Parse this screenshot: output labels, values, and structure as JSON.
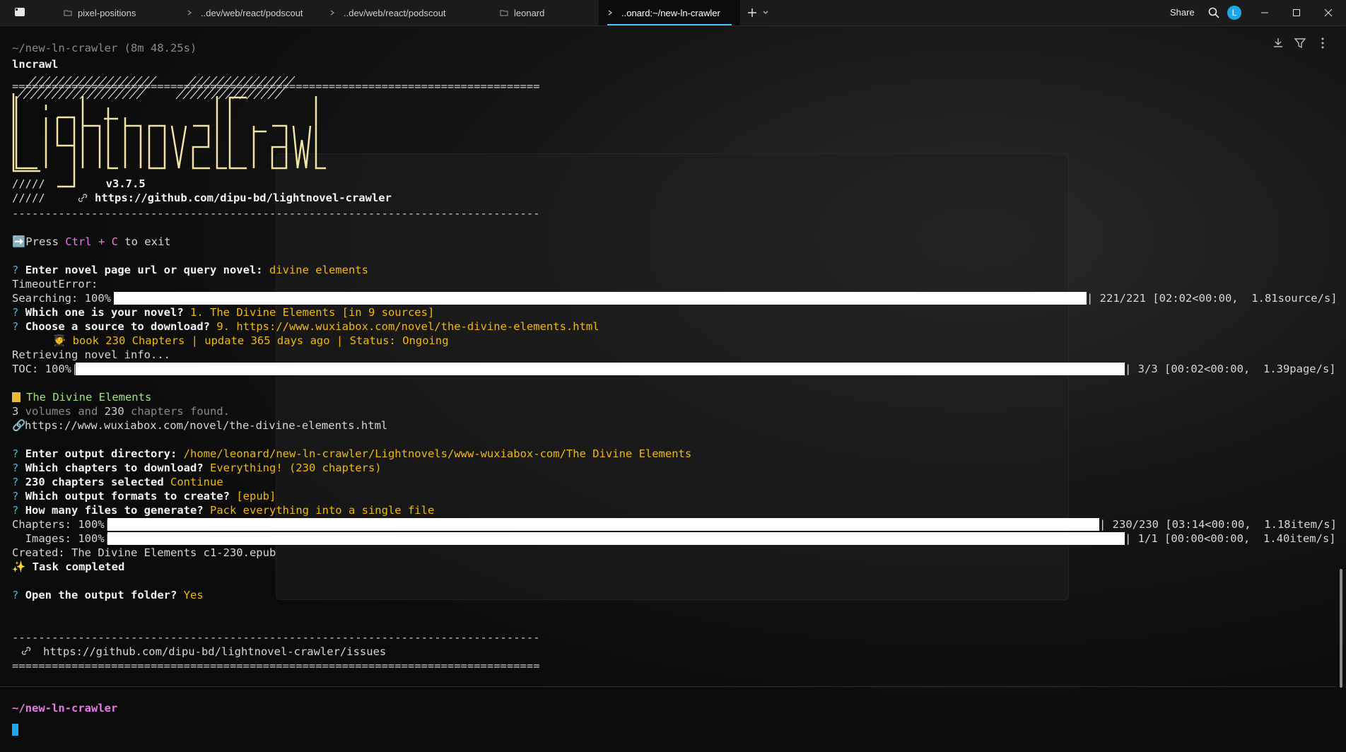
{
  "titlebar": {
    "tabs": [
      {
        "label": "pixel-positions",
        "icon": "folder-icon",
        "active": false
      },
      {
        "label": "..dev/web/react/podscout",
        "icon": "terminal-prompt-icon",
        "active": false
      },
      {
        "label": "..dev/web/react/podscout",
        "icon": "terminal-prompt-icon",
        "active": false
      },
      {
        "label": "leonard",
        "icon": "folder-icon",
        "active": false
      },
      {
        "label": "..onard:~/new-ln-crawler",
        "icon": "terminal-prompt-icon",
        "active": true
      }
    ],
    "share_label": "Share",
    "avatar_initial": "L",
    "accent": "#4cc2ff"
  },
  "terminal": {
    "header_path": "~/new-ln-crawler (8m 48.25s)",
    "command": "lncrawl",
    "sep_double": "================================================================================",
    "sep_single": "--------------------------------------------------------------------------------",
    "logo_text": "Lightnovel Crawler",
    "logo_slashes": "/////",
    "version": "v3.7.5",
    "repo_url": "https://github.com/dipu-bd/lightnovel-crawler",
    "press_prefix": "➡️Press ",
    "press_keys": "Ctrl + C",
    "press_suffix": " to exit",
    "q_mark": "?",
    "q1": "Enter novel page url or query novel:",
    "a1": "divine elements",
    "timeout": "TimeoutError:",
    "search_label": "Searching: 100%|",
    "search_tail": "| 221/221 [02:02<00:00,  1.81source/s]",
    "q2": "Which one is your novel?",
    "a2": "1. The Divine Elements [in 9 sources]",
    "q3": "Choose a source to download?",
    "a3": "9. https://www.wuxiabox.com/novel/the-divine-elements.html",
    "book_info": "🧑‍🎓 book 230 Chapters | update 365 days ago | Status: Ongoing",
    "retrieving": "Retrieving novel info...",
    "toc_label": "TOC: 100%|",
    "toc_tail": "| 3/3 [00:02<00:00,  1.39page/s]",
    "novel_title": "The Divine Elements",
    "volumes_count": "3",
    "volumes_mid": " volumes and ",
    "chapters_count": "230",
    "chapters_suffix": " chapters found.",
    "novel_url": "https://www.wuxiabox.com/novel/the-divine-elements.html",
    "q4": "Enter output directory:",
    "a4": "/home/leonard/new-ln-crawler/Lightnovels/www-wuxiabox-com/The Divine Elements",
    "q5": "Which chapters to download?",
    "a5": "Everything! (230 chapters)",
    "q6": "230 chapters selected",
    "a6": "Continue",
    "q7": "Which output formats to create?",
    "a7": "[epub]",
    "q8": "How many files to generate?",
    "a8": "Pack everything into a single file",
    "chapters_label": "Chapters: 100%|",
    "chapters_tail": "| 230/230 [03:14<00:00,  1.18item/s]",
    "images_label": "  Images: 100%|",
    "images_tail": "| 1/1 [00:00<00:00,  1.40item/s]",
    "created": "Created: The Divine Elements c1-230.epub",
    "task_done": "✨ Task completed",
    "q9": "Open the output folder?",
    "a9": "Yes",
    "issues_url": "https://github.com/dipu-bd/lightnovel-crawler/issues",
    "prompt_path": "~/new-ln-crawler",
    "progress": {
      "searching": 1.0,
      "toc": 1.0,
      "chapters": 1.0,
      "images": 1.0
    }
  },
  "colors": {
    "answer": "#f0b90b",
    "prompt": "#e77be6",
    "cursor": "#1ea7e8"
  }
}
